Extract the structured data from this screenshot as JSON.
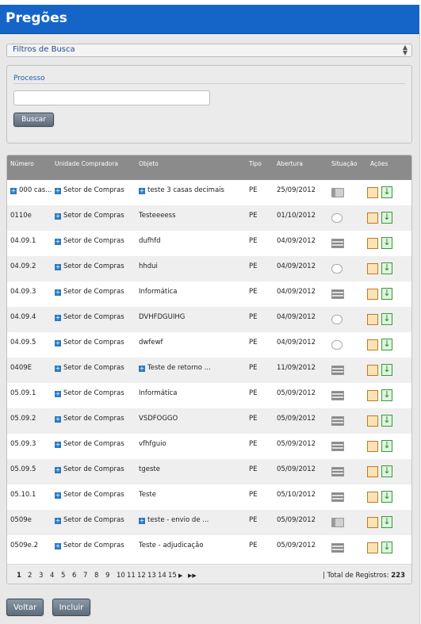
{
  "header": {
    "title": "Pregões"
  },
  "filters": {
    "label": "Filtros de Busca"
  },
  "processo": {
    "label": "Processo",
    "value": "",
    "button": "Buscar"
  },
  "table": {
    "columns": [
      "Número",
      "Unidade Compradora",
      "Objeto",
      "Tipo",
      "Abertura",
      "Situação",
      "Ações"
    ],
    "rows": [
      {
        "numero": "000 cas...",
        "unidade": "Setor de Compras",
        "objeto": "teste 3 casas decimais",
        "objeto_plus": true,
        "tipo": "PE",
        "abertura": "25/09/2012",
        "situacao": "a"
      },
      {
        "numero": "0110e",
        "unidade": "Setor de Compras",
        "objeto": "Testeeeess",
        "objeto_plus": false,
        "tipo": "PE",
        "abertura": "01/10/2012",
        "situacao": "b"
      },
      {
        "numero": "04.09.1",
        "unidade": "Setor de Compras",
        "objeto": "dufhfd",
        "objeto_plus": false,
        "tipo": "PE",
        "abertura": "04/09/2012",
        "situacao": "c"
      },
      {
        "numero": "04.09.2",
        "unidade": "Setor de Compras",
        "objeto": "hhdui",
        "objeto_plus": false,
        "tipo": "PE",
        "abertura": "04/09/2012",
        "situacao": "b"
      },
      {
        "numero": "04.09.3",
        "unidade": "Setor de Compras",
        "objeto": "Informática",
        "objeto_plus": false,
        "tipo": "PE",
        "abertura": "04/09/2012",
        "situacao": "c"
      },
      {
        "numero": "04.09.4",
        "unidade": "Setor de Compras",
        "objeto": "DVHFDGUIHG",
        "objeto_plus": false,
        "tipo": "PE",
        "abertura": "04/09/2012",
        "situacao": "b"
      },
      {
        "numero": "04.09.5",
        "unidade": "Setor de Compras",
        "objeto": "dwfewf",
        "objeto_plus": false,
        "tipo": "PE",
        "abertura": "04/09/2012",
        "situacao": "b"
      },
      {
        "numero": "0409E",
        "unidade": "Setor de Compras",
        "objeto": "Teste de retorno ...",
        "objeto_plus": true,
        "tipo": "PE",
        "abertura": "11/09/2012",
        "situacao": "c"
      },
      {
        "numero": "05.09.1",
        "unidade": "Setor de Compras",
        "objeto": "Informática",
        "objeto_plus": false,
        "tipo": "PE",
        "abertura": "05/09/2012",
        "situacao": "c"
      },
      {
        "numero": "05.09.2",
        "unidade": "Setor de Compras",
        "objeto": "VSDFOGGO",
        "objeto_plus": false,
        "tipo": "PE",
        "abertura": "05/09/2012",
        "situacao": "c"
      },
      {
        "numero": "05.09.3",
        "unidade": "Setor de Compras",
        "objeto": "vfhfguio",
        "objeto_plus": false,
        "tipo": "PE",
        "abertura": "05/09/2012",
        "situacao": "c"
      },
      {
        "numero": "05.09.5",
        "unidade": "Setor de Compras",
        "objeto": "tgeste",
        "objeto_plus": false,
        "tipo": "PE",
        "abertura": "05/09/2012",
        "situacao": "c"
      },
      {
        "numero": "05.10.1",
        "unidade": "Setor de Compras",
        "objeto": "Teste",
        "objeto_plus": false,
        "tipo": "PE",
        "abertura": "05/10/2012",
        "situacao": "c"
      },
      {
        "numero": "0509e",
        "unidade": "Setor de Compras",
        "objeto": "teste - envio de ...",
        "objeto_plus": true,
        "tipo": "PE",
        "abertura": "05/09/2012",
        "situacao": "a"
      },
      {
        "numero": "0509e.2",
        "unidade": "Setor de Compras",
        "objeto": "Teste - adjudicação",
        "objeto_plus": false,
        "tipo": "PE",
        "abertura": "05/09/2012",
        "situacao": "c"
      }
    ]
  },
  "pager": {
    "pages": [
      "1",
      "2",
      "3",
      "4",
      "5",
      "6",
      "7",
      "8",
      "9",
      "10",
      "11",
      "12",
      "13",
      "14",
      "15"
    ],
    "next": "▶",
    "last": "▶▶",
    "total_label": "| Total de Registros:",
    "total_value": "223"
  },
  "footer": {
    "back": "Voltar",
    "add": "Incluir"
  }
}
